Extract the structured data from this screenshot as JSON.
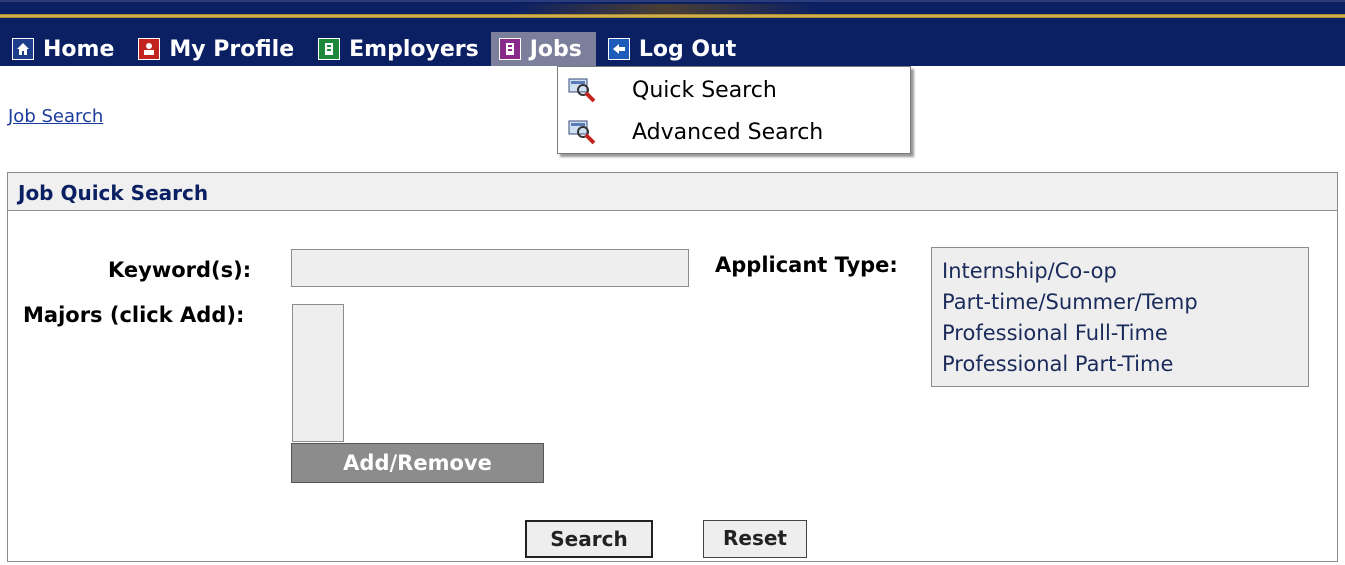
{
  "nav": {
    "items": [
      {
        "label": "Home",
        "icon": "home-icon"
      },
      {
        "label": "My Profile",
        "icon": "profile-icon"
      },
      {
        "label": "Employers",
        "icon": "employers-icon"
      },
      {
        "label": "Jobs",
        "icon": "jobs-icon"
      },
      {
        "label": "Log Out",
        "icon": "logout-icon"
      }
    ],
    "active": "Jobs"
  },
  "jobs_menu": {
    "items": [
      {
        "label": "Quick Search",
        "icon": "search-magnifier-icon"
      },
      {
        "label": "Advanced Search",
        "icon": "search-magnifier-icon"
      }
    ]
  },
  "breadcrumb": "Job Search",
  "panel": {
    "title": "Job Quick Search",
    "keyword_label": "Keyword(s):",
    "keyword_value": "",
    "majors_label": "Majors (click Add):",
    "add_remove_label": "Add/Remove",
    "applicant_type_label": "Applicant Type:",
    "applicant_types": [
      "Internship/Co-op",
      "Part-time/Summer/Temp",
      "Professional Full-Time",
      "Professional Part-Time"
    ],
    "search_label": "Search",
    "reset_label": "Reset"
  },
  "colors": {
    "nav_background": "#0b1f63",
    "nav_active": "#7b7f9b",
    "panel_title": "#0b1f63"
  }
}
